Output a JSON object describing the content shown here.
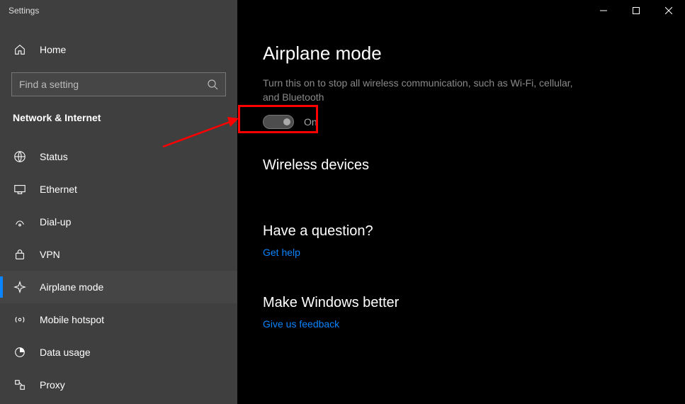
{
  "window": {
    "title": "Settings"
  },
  "sidebar": {
    "home_label": "Home",
    "search_placeholder": "Find a setting",
    "category_label": "Network & Internet",
    "items": [
      {
        "label": "Status"
      },
      {
        "label": "Ethernet"
      },
      {
        "label": "Dial-up"
      },
      {
        "label": "VPN"
      },
      {
        "label": "Airplane mode"
      },
      {
        "label": "Mobile hotspot"
      },
      {
        "label": "Data usage"
      },
      {
        "label": "Proxy"
      }
    ]
  },
  "main": {
    "title": "Airplane mode",
    "description": "Turn this on to stop all wireless communication, such as Wi-Fi, cellular, and Bluetooth",
    "toggle_label": "On",
    "section1_title": "Wireless devices",
    "help_title": "Have a question?",
    "help_link": "Get help",
    "feedback_title": "Make Windows better",
    "feedback_link": "Give us feedback"
  }
}
